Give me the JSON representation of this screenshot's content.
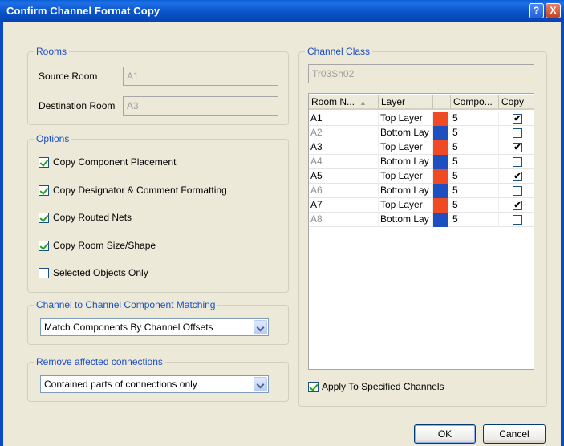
{
  "window": {
    "title": "Confirm Channel Format Copy",
    "help_glyph": "?",
    "close_glyph": "X"
  },
  "rooms": {
    "legend": "Rooms",
    "source_label": "Source Room",
    "source_value": "A1",
    "destination_label": "Destination Room",
    "destination_value": "A3"
  },
  "options": {
    "legend": "Options",
    "items": [
      {
        "label": "Copy Component Placement",
        "checked": true
      },
      {
        "label": "Copy Designator & Comment Formatting",
        "checked": true
      },
      {
        "label": "Copy Routed Nets",
        "checked": true
      },
      {
        "label": "Copy Room Size/Shape",
        "checked": true
      },
      {
        "label": "Selected Objects Only",
        "checked": false
      }
    ]
  },
  "matching": {
    "legend": "Channel to Channel Component Matching",
    "selected": "Match Components By Channel Offsets"
  },
  "remove": {
    "legend": "Remove affected connections",
    "selected": "Contained parts of connections only"
  },
  "channel_class": {
    "legend": "Channel Class",
    "value": "Tr03Sh02",
    "columns": [
      "Room N...",
      "Layer",
      "",
      "Compo...",
      "Copy"
    ],
    "colors": {
      "top_layer": "#F04A24",
      "bottom_layer": "#1E4FC0"
    },
    "rows": [
      {
        "room": "A1",
        "layer": "Top Layer",
        "color": "#F04A24",
        "comp": "5",
        "copy": true,
        "dim": false
      },
      {
        "room": "A2",
        "layer": "Bottom Lay",
        "color": "#1E4FC0",
        "comp": "5",
        "copy": false,
        "dim": true
      },
      {
        "room": "A3",
        "layer": "Top Layer",
        "color": "#F04A24",
        "comp": "5",
        "copy": true,
        "dim": false
      },
      {
        "room": "A4",
        "layer": "Bottom Lay",
        "color": "#1E4FC0",
        "comp": "5",
        "copy": false,
        "dim": true
      },
      {
        "room": "A5",
        "layer": "Top Layer",
        "color": "#F04A24",
        "comp": "5",
        "copy": true,
        "dim": false
      },
      {
        "room": "A6",
        "layer": "Bottom Lay",
        "color": "#1E4FC0",
        "comp": "5",
        "copy": false,
        "dim": true
      },
      {
        "room": "A7",
        "layer": "Top Layer",
        "color": "#F04A24",
        "comp": "5",
        "copy": true,
        "dim": false
      },
      {
        "room": "A8",
        "layer": "Bottom Lay",
        "color": "#1E4FC0",
        "comp": "5",
        "copy": false,
        "dim": true
      }
    ],
    "apply_label": "Apply To Specified Channels",
    "apply_checked": true
  },
  "buttons": {
    "ok": "OK",
    "cancel": "Cancel"
  }
}
